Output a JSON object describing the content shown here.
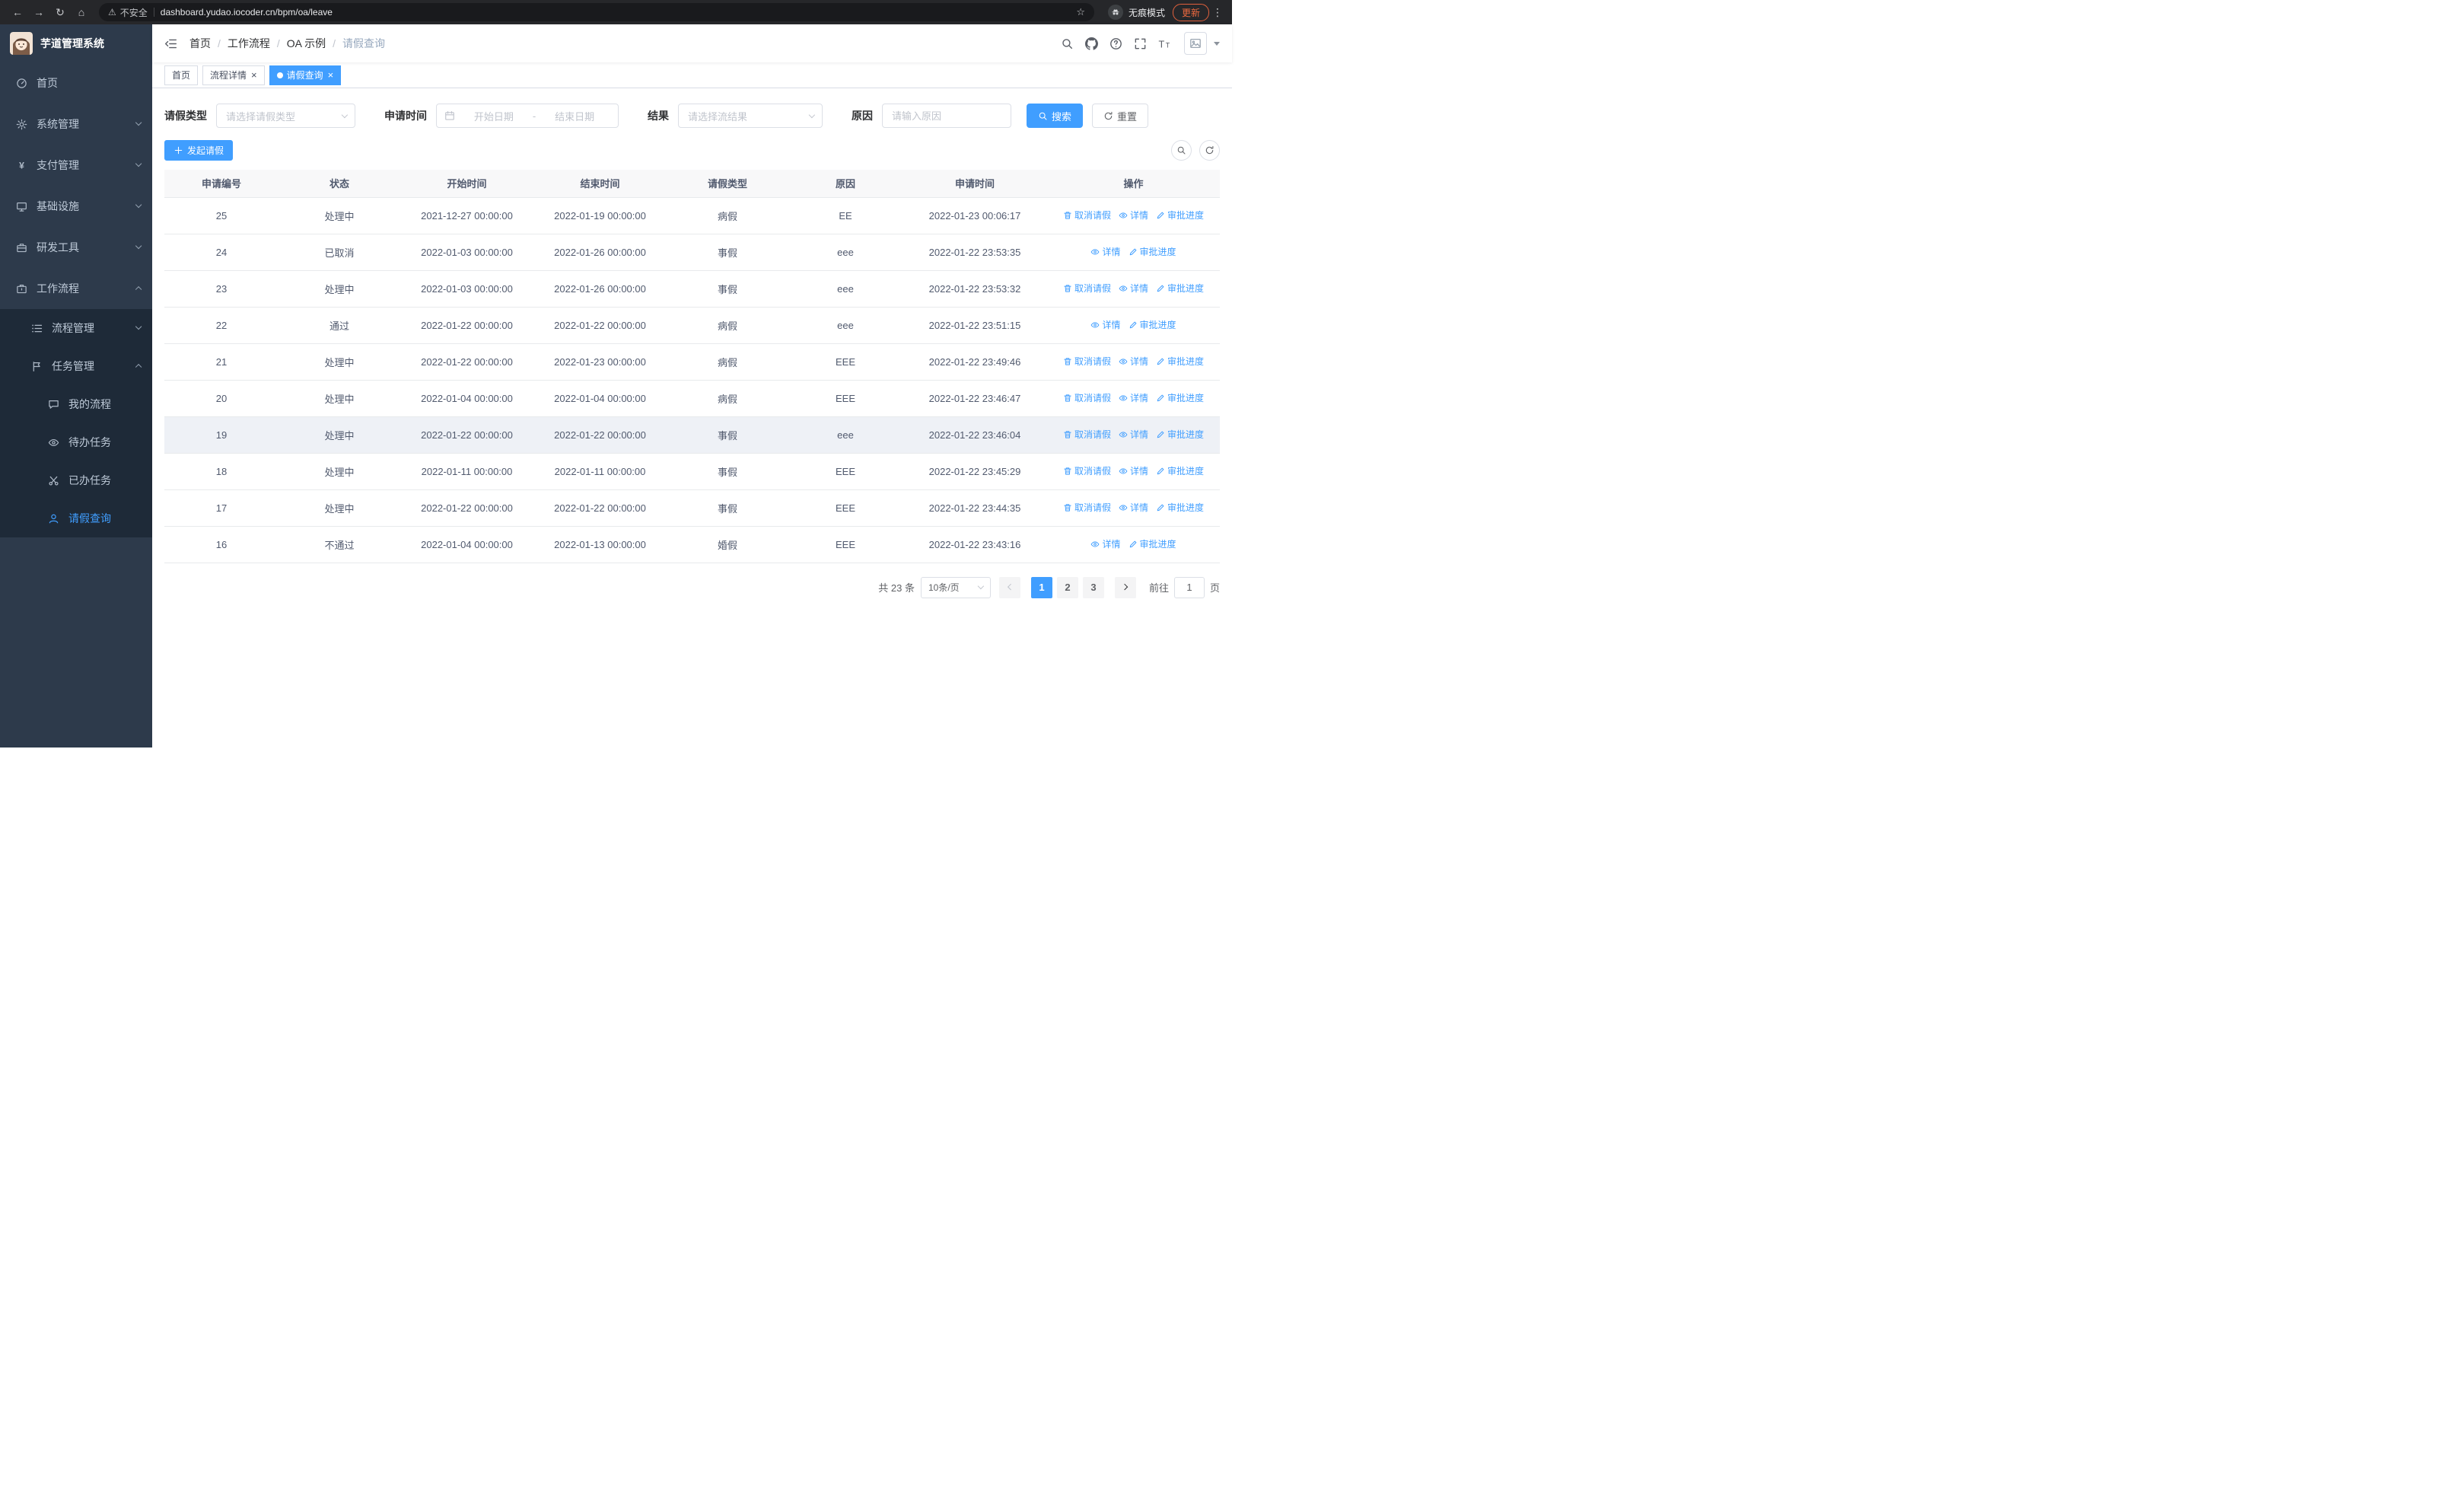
{
  "browser": {
    "security_warning": "不安全",
    "url": "dashboard.yudao.iocoder.cn/bpm/oa/leave",
    "incognito_label": "无痕模式",
    "update_label": "更新"
  },
  "sidebar": {
    "app_title": "芋道管理系统",
    "menu": [
      {
        "name": "home",
        "label": "首页",
        "icon": "gauge-icon",
        "level": 1
      },
      {
        "name": "system",
        "label": "系统管理",
        "icon": "gear-icon",
        "level": 1,
        "chevron": "down"
      },
      {
        "name": "payment",
        "label": "支付管理",
        "icon": "yen-icon",
        "level": 1,
        "chevron": "down"
      },
      {
        "name": "infrastructure",
        "label": "基础设施",
        "icon": "monitor-icon",
        "level": 1,
        "chevron": "down"
      },
      {
        "name": "dev-tools",
        "label": "研发工具",
        "icon": "toolbox-icon",
        "level": 1,
        "chevron": "down"
      },
      {
        "name": "workflow",
        "label": "工作流程",
        "icon": "briefcase-icon",
        "level": 1,
        "chevron": "up"
      },
      {
        "name": "process-management",
        "label": "流程管理",
        "icon": "list-icon",
        "level": 2,
        "chevron": "down"
      },
      {
        "name": "task-management",
        "label": "任务管理",
        "icon": "flag-icon",
        "level": 2,
        "chevron": "up"
      },
      {
        "name": "my-process",
        "label": "我的流程",
        "icon": "chat-icon",
        "level": 3
      },
      {
        "name": "todo-tasks",
        "label": "待办任务",
        "icon": "eye-icon",
        "level": 3
      },
      {
        "name": "done-tasks",
        "label": "已办任务",
        "icon": "scissors-icon",
        "level": 3
      },
      {
        "name": "leave-query",
        "label": "请假查询",
        "icon": "user-icon",
        "level": 3,
        "active": true
      }
    ]
  },
  "nav": {
    "breadcrumb": [
      "首页",
      "工作流程",
      "OA 示例",
      "请假查询"
    ],
    "separator": "/"
  },
  "tabs": {
    "items": [
      {
        "name": "home",
        "label": "首页",
        "closable": false,
        "active": false
      },
      {
        "name": "process-detail",
        "label": "流程详情",
        "closable": true,
        "active": false
      },
      {
        "name": "leave-query",
        "label": "请假查询",
        "closable": true,
        "active": true
      }
    ]
  },
  "filters": {
    "leave_type_label": "请假类型",
    "leave_type_placeholder": "请选择请假类型",
    "apply_time_label": "申请时间",
    "start_date_placeholder": "开始日期",
    "range_separator": "-",
    "end_date_placeholder": "结束日期",
    "result_label": "结果",
    "result_placeholder": "请选择流结果",
    "reason_label": "原因",
    "reason_placeholder": "请输入原因",
    "search_label": "搜索",
    "reset_label": "重置"
  },
  "toolbar": {
    "create_label": "发起请假"
  },
  "table": {
    "columns": [
      "申请编号",
      "状态",
      "开始时间",
      "结束时间",
      "请假类型",
      "原因",
      "申请时间",
      "操作"
    ],
    "actions": {
      "cancel": "取消请假",
      "detail": "详情",
      "progress": "审批进度"
    },
    "rows": [
      {
        "id": "25",
        "status": "处理中",
        "start": "2021-12-27 00:00:00",
        "end": "2022-01-19 00:00:00",
        "type": "病假",
        "reason": "EE",
        "applied": "2022-01-23 00:06:17",
        "cancellable": true
      },
      {
        "id": "24",
        "status": "已取消",
        "start": "2022-01-03 00:00:00",
        "end": "2022-01-26 00:00:00",
        "type": "事假",
        "reason": "eee",
        "applied": "2022-01-22 23:53:35",
        "cancellable": false
      },
      {
        "id": "23",
        "status": "处理中",
        "start": "2022-01-03 00:00:00",
        "end": "2022-01-26 00:00:00",
        "type": "事假",
        "reason": "eee",
        "applied": "2022-01-22 23:53:32",
        "cancellable": true
      },
      {
        "id": "22",
        "status": "通过",
        "start": "2022-01-22 00:00:00",
        "end": "2022-01-22 00:00:00",
        "type": "病假",
        "reason": "eee",
        "applied": "2022-01-22 23:51:15",
        "cancellable": false
      },
      {
        "id": "21",
        "status": "处理中",
        "start": "2022-01-22 00:00:00",
        "end": "2022-01-23 00:00:00",
        "type": "病假",
        "reason": "EEE",
        "applied": "2022-01-22 23:49:46",
        "cancellable": true
      },
      {
        "id": "20",
        "status": "处理中",
        "start": "2022-01-04 00:00:00",
        "end": "2022-01-04 00:00:00",
        "type": "病假",
        "reason": "EEE",
        "applied": "2022-01-22 23:46:47",
        "cancellable": true
      },
      {
        "id": "19",
        "status": "处理中",
        "start": "2022-01-22 00:00:00",
        "end": "2022-01-22 00:00:00",
        "type": "事假",
        "reason": "eee",
        "applied": "2022-01-22 23:46:04",
        "cancellable": true,
        "highlight": true
      },
      {
        "id": "18",
        "status": "处理中",
        "start": "2022-01-11 00:00:00",
        "end": "2022-01-11 00:00:00",
        "type": "事假",
        "reason": "EEE",
        "applied": "2022-01-22 23:45:29",
        "cancellable": true
      },
      {
        "id": "17",
        "status": "处理中",
        "start": "2022-01-22 00:00:00",
        "end": "2022-01-22 00:00:00",
        "type": "事假",
        "reason": "EEE",
        "applied": "2022-01-22 23:44:35",
        "cancellable": true
      },
      {
        "id": "16",
        "status": "不通过",
        "start": "2022-01-04 00:00:00",
        "end": "2022-01-13 00:00:00",
        "type": "婚假",
        "reason": "EEE",
        "applied": "2022-01-22 23:43:16",
        "cancellable": false
      }
    ]
  },
  "pagination": {
    "total": "共 23 条",
    "page_size": "10条/页",
    "pages": [
      "1",
      "2",
      "3"
    ],
    "active_page": "1",
    "goto_label": "前往",
    "goto_value": "1",
    "page_label": "页"
  },
  "colors": {
    "primary": "#409eff",
    "sidebar_bg": "#2d3a4b",
    "submenu_bg": "#1e2a38",
    "table_header_bg": "#f8f8f9",
    "update_pill": "#ee6a3f"
  }
}
